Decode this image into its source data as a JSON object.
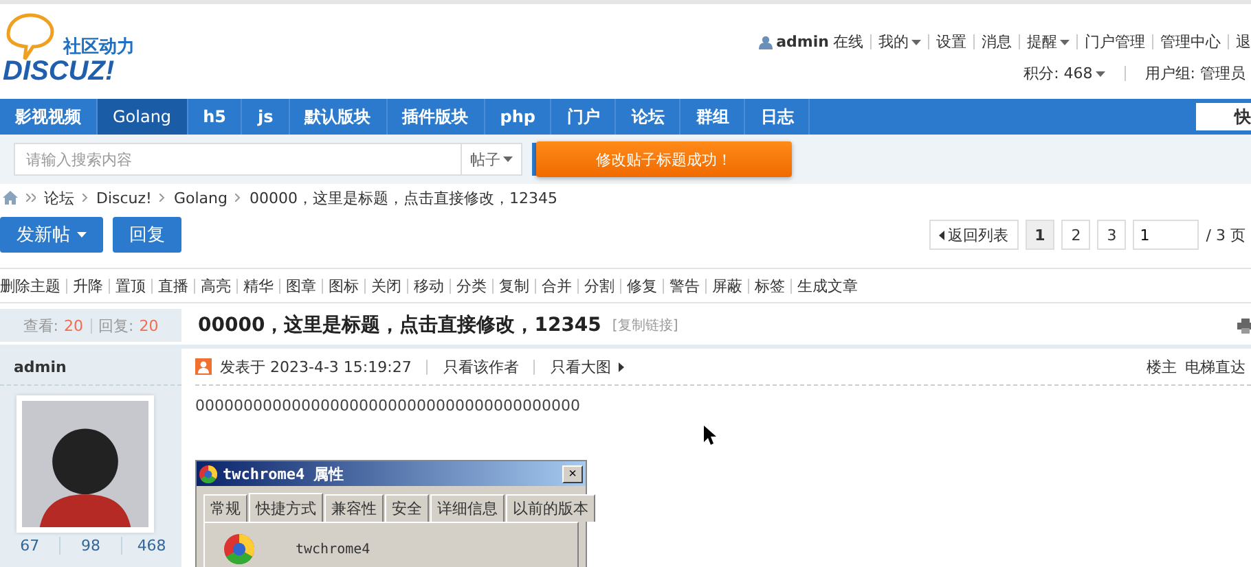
{
  "logo": {
    "tagline": "社区动力",
    "wordmark": "DISCUZ!"
  },
  "user_bar": {
    "username": "admin",
    "status": "在线",
    "links": [
      {
        "label": "我的",
        "dropdown": true
      },
      {
        "label": "设置",
        "dropdown": false
      },
      {
        "label": "消息",
        "dropdown": false
      },
      {
        "label": "提醒",
        "dropdown": true
      },
      {
        "label": "门户管理",
        "dropdown": false
      },
      {
        "label": "管理中心",
        "dropdown": false
      },
      {
        "label": "退",
        "dropdown": false
      }
    ],
    "points": "积分: 468",
    "group": "用户组: 管理员"
  },
  "nav": [
    {
      "label": "影视视频",
      "selected": false
    },
    {
      "label": "Golang",
      "selected": true
    },
    {
      "label": "h5",
      "selected": false
    },
    {
      "label": "js",
      "selected": false
    },
    {
      "label": "默认版块",
      "selected": false
    },
    {
      "label": "插件版块",
      "selected": false
    },
    {
      "label": "php",
      "selected": false
    },
    {
      "label": "门户",
      "selected": false
    },
    {
      "label": "论坛",
      "selected": false
    },
    {
      "label": "群组",
      "selected": false
    },
    {
      "label": "日志",
      "selected": false
    }
  ],
  "quick_button": "快",
  "search": {
    "placeholder": "请输入搜索内容",
    "type": "帖子"
  },
  "toast": "修改贴子标题成功！",
  "breadcrumb": [
    "论坛",
    "Discuz!",
    "Golang",
    "00000，这里是标题，点击直接修改，12345"
  ],
  "actions": {
    "new_thread": "发新帖",
    "reply": "回复"
  },
  "pagination": {
    "back": "返回列表",
    "pages": [
      {
        "label": "1",
        "selected": true
      },
      {
        "label": "2",
        "selected": false
      },
      {
        "label": "3",
        "selected": false
      }
    ],
    "page_input": "1",
    "total": "/ 3 页"
  },
  "mod_tools": [
    "删除主题",
    "升降",
    "置顶",
    "直播",
    "高亮",
    "精华",
    "图章",
    "图标",
    "关闭",
    "移动",
    "分类",
    "复制",
    "合并",
    "分割",
    "修复",
    "警告",
    "屏蔽",
    "标签",
    "生成文章"
  ],
  "thread": {
    "views_label": "查看:",
    "views": "20",
    "replies_label": "回复:",
    "replies": "20",
    "title": "00000，这里是标题，点击直接修改，12345",
    "copy_link": "[复制链接]"
  },
  "post": {
    "author": "admin",
    "stats": [
      "67",
      "98",
      "468"
    ],
    "posted": "发表于 2023-4-3 15:19:27",
    "only_author": "只看该作者",
    "large_images": "只看大图",
    "floor": "楼主",
    "jump": "电梯直达",
    "content": "0000000000000000000000000000000000000000"
  },
  "attachment_dialog": {
    "title": "twchrome4 属性",
    "close": "×",
    "tabs": [
      {
        "label": "常规",
        "selected": false
      },
      {
        "label": "快捷方式",
        "selected": true
      },
      {
        "label": "兼容性",
        "selected": false
      },
      {
        "label": "安全",
        "selected": false
      },
      {
        "label": "详细信息",
        "selected": false
      },
      {
        "label": "以前的版本",
        "selected": false
      }
    ],
    "name": "twchrome4"
  }
}
